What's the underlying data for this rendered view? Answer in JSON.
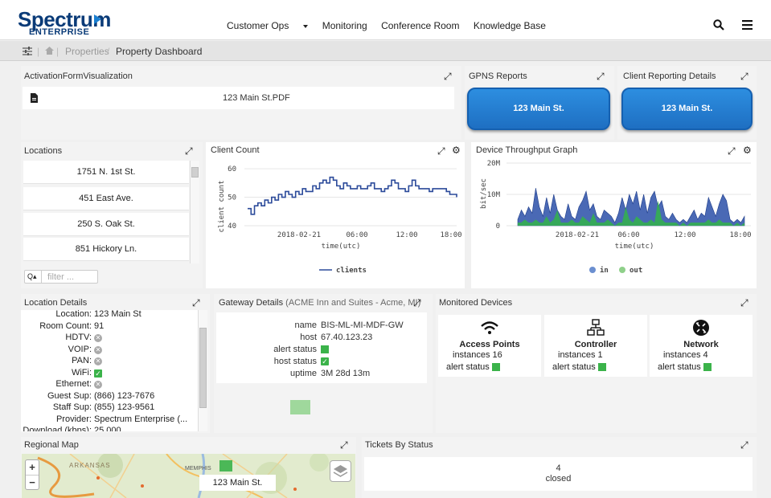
{
  "brand": {
    "name": "Spectrum",
    "sub": "ENTERPRISE"
  },
  "nav": {
    "items": [
      "Customer Ops",
      "Monitoring",
      "Conference Room",
      "Knowledge Base"
    ]
  },
  "breadcrumb": {
    "home": "Properties",
    "current": "Property Dashboard",
    "separator": "/"
  },
  "activation": {
    "title": "ActivationFormVisualization",
    "file": "123 Main St.PDF"
  },
  "gpns": {
    "title": "GPNS Reports",
    "button": "123 Main St."
  },
  "client_reporting": {
    "title": "Client Reporting Details",
    "button": "123 Main St."
  },
  "locations": {
    "title": "Locations",
    "items": [
      "1751 N. 1st St.",
      "451 East Ave.",
      "250 S. Oak St.",
      "851 Hickory Ln."
    ],
    "filter_placeholder": "filter ..."
  },
  "client_count": {
    "title": "Client Count",
    "ylabel": "client count",
    "xlabel": "time(utc)",
    "legend": "clients"
  },
  "throughput": {
    "title": "Device Throughput Graph",
    "ylabel": "bit/sec",
    "xlabel": "time(utc)",
    "legend_in": "in",
    "legend_out": "out"
  },
  "location_details": {
    "title": "Location Details",
    "rows": [
      {
        "k": "Location:",
        "v": "123 Main St",
        "type": "text"
      },
      {
        "k": "Room Count:",
        "v": "91",
        "type": "text"
      },
      {
        "k": "HDTV:",
        "v": "",
        "type": "x"
      },
      {
        "k": "VOIP:",
        "v": "",
        "type": "x"
      },
      {
        "k": "PAN:",
        "v": "",
        "type": "x"
      },
      {
        "k": "WiFi:",
        "v": "",
        "type": "ok"
      },
      {
        "k": "Ethernet:",
        "v": "",
        "type": "x"
      },
      {
        "k": "Guest Sup:",
        "v": "(866) 123-7676",
        "type": "text"
      },
      {
        "k": "Staff Sup:",
        "v": "(855) 123-9561",
        "type": "text"
      },
      {
        "k": "Provider:",
        "v": "Spectrum Enterprise (...",
        "type": "text"
      },
      {
        "k": "Download (kbps):",
        "v": "25,000",
        "type": "text"
      }
    ]
  },
  "gateway": {
    "title": "Gateway Details",
    "subtitle": "(ACME Inn and Suites - Acme, MI)",
    "name_label": "name",
    "name": "BIS-ML-MI-MDF-GW",
    "host_label": "host",
    "host": "67.40.123.23",
    "alert_label": "alert status",
    "host_status_label": "host status",
    "uptime_label": "uptime",
    "uptime": "3M 28d 13m"
  },
  "monitored": {
    "title": "Monitored Devices",
    "devices": [
      {
        "name": "Access Points",
        "instances": "instances 16",
        "alert": "alert status",
        "icon": "wifi-icon"
      },
      {
        "name": "Controller",
        "instances": "instances 1",
        "alert": "alert status",
        "icon": "network-tree-icon"
      },
      {
        "name": "Network",
        "instances": "instances 4",
        "alert": "alert status",
        "icon": "router-icon"
      }
    ]
  },
  "regional_map": {
    "title": "Regional Map",
    "zoom_in": "+",
    "zoom_out": "−",
    "state": "ARKANSAS",
    "city": "MEMPHIS",
    "label": "123 Main St."
  },
  "tickets": {
    "title": "Tickets By Status",
    "count": "4",
    "status": "closed"
  },
  "chart_data": [
    {
      "type": "line",
      "title": "Client Count",
      "xlabel": "time(utc)",
      "ylabel": "client count",
      "x_ticks": [
        "2018-02-21",
        "06:00",
        "12:00",
        "18:00"
      ],
      "y_ticks": [
        40,
        50,
        60
      ],
      "ylim": [
        40,
        62
      ],
      "series": [
        {
          "name": "clients",
          "color": "#2b4a9a",
          "values": [
            46,
            44,
            47,
            48,
            47,
            49,
            48,
            50,
            49,
            51,
            50,
            52,
            51,
            50,
            52,
            51,
            53,
            52,
            52,
            54,
            53,
            55,
            56,
            55,
            57,
            56,
            54,
            53,
            55,
            54,
            53,
            53,
            54,
            53,
            53,
            54,
            55,
            53,
            53,
            52,
            53,
            54,
            56,
            55,
            53,
            53,
            52,
            54,
            56,
            54,
            53,
            53,
            53,
            52,
            53,
            53,
            53,
            53,
            52,
            51,
            51,
            50
          ]
        }
      ]
    },
    {
      "type": "area",
      "title": "Device Throughput Graph",
      "xlabel": "time(utc)",
      "ylabel": "bit/sec",
      "x_ticks": [
        "2018-02-21",
        "06:00",
        "12:00",
        "18:00"
      ],
      "y_ticks": [
        "0",
        "10M",
        "20M"
      ],
      "ylim": [
        0,
        20
      ],
      "series": [
        {
          "name": "in",
          "color": "#2a4fa8",
          "values": [
            2,
            5,
            3,
            6,
            4,
            12,
            6,
            3,
            9,
            4,
            10,
            5,
            3,
            2,
            7,
            3,
            2,
            6,
            8,
            11,
            5,
            7,
            3,
            2,
            5,
            4,
            3,
            1,
            4,
            9,
            5,
            10,
            7,
            11,
            5,
            10,
            4,
            9,
            11,
            6,
            8,
            3,
            2,
            4,
            2,
            1,
            2,
            1,
            3,
            5,
            2,
            4,
            3,
            9,
            6,
            3,
            7,
            10,
            8,
            2,
            1,
            2,
            1,
            3
          ]
        },
        {
          "name": "out",
          "color": "#33b44a",
          "values": [
            1,
            1,
            2,
            1,
            1,
            2,
            1,
            1,
            3,
            1,
            2,
            5,
            1,
            1,
            1,
            2,
            1,
            1,
            3,
            2,
            1,
            4,
            1,
            1,
            1,
            2,
            1,
            0,
            1,
            1,
            6,
            2,
            1,
            3,
            2,
            1,
            1,
            2,
            1,
            8,
            2,
            1,
            1,
            1,
            1,
            0,
            1,
            0,
            1,
            1,
            1,
            1,
            1,
            2,
            1,
            1,
            2,
            1,
            1,
            1,
            0,
            1,
            0,
            1
          ]
        }
      ]
    }
  ]
}
